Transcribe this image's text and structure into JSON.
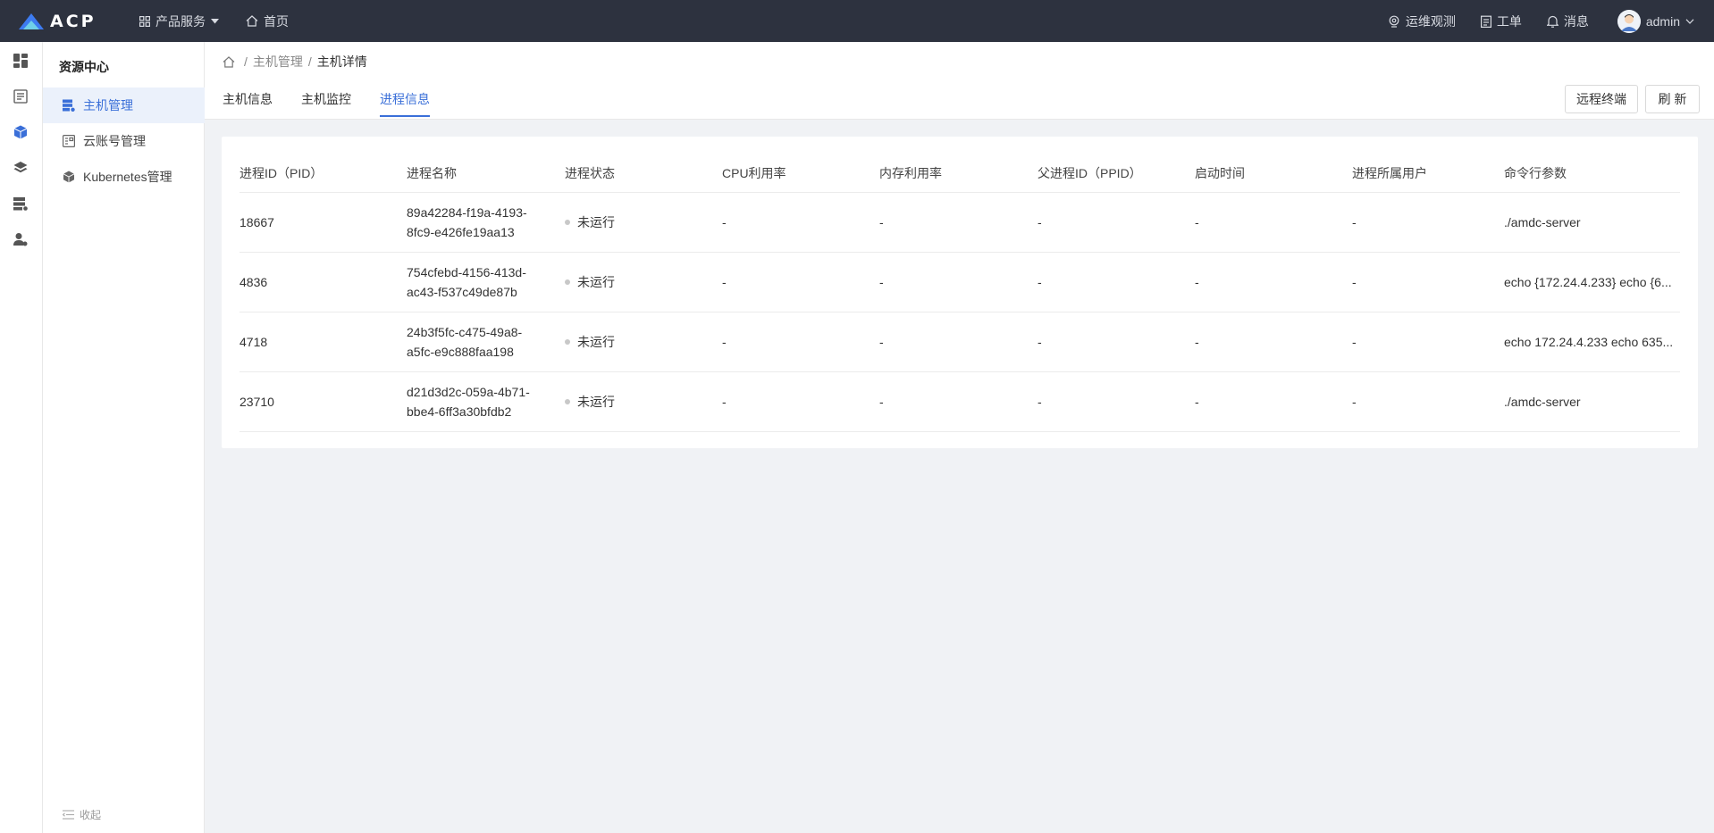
{
  "app": {
    "logo_text": "ACP"
  },
  "topnav": {
    "products": "产品服务",
    "home": "首页"
  },
  "topright": {
    "observe": "运维观测",
    "ticket": "工单",
    "message": "消息",
    "user": "admin"
  },
  "sidebar": {
    "title": "资源中心",
    "items": [
      {
        "label": "主机管理",
        "icon": "host-icon",
        "active": true
      },
      {
        "label": "云账号管理",
        "icon": "account-icon",
        "active": false
      },
      {
        "label": "Kubernetes管理",
        "icon": "cube-icon",
        "active": false
      }
    ],
    "collapse": "收起"
  },
  "breadcrumb": {
    "parent": "主机管理",
    "current": "主机详情"
  },
  "tabs": [
    "主机信息",
    "主机监控",
    "进程信息"
  ],
  "buttons": {
    "terminal": "远程终端",
    "refresh": "刷 新"
  },
  "table": {
    "headers": [
      "进程ID（PID）",
      "进程名称",
      "进程状态",
      "CPU利用率",
      "内存利用率",
      "父进程ID（PPID）",
      "启动时间",
      "进程所属用户",
      "命令行参数"
    ],
    "rows": [
      {
        "pid": "18667",
        "name1": "89a42284-f19a-4193-",
        "name2": "8fc9-e426fe19aa13",
        "status": "未运行",
        "cpu": "-",
        "mem": "-",
        "ppid": "-",
        "start": "-",
        "user": "-",
        "cmd": "./amdc-server"
      },
      {
        "pid": "4836",
        "name1": "754cfebd-4156-413d-",
        "name2": "ac43-f537c49de87b",
        "status": "未运行",
        "cpu": "-",
        "mem": "-",
        "ppid": "-",
        "start": "-",
        "user": "-",
        "cmd": "echo {172.24.4.233} echo {6..."
      },
      {
        "pid": "4718",
        "name1": "24b3f5fc-c475-49a8-",
        "name2": "a5fc-e9c888faa198",
        "status": "未运行",
        "cpu": "-",
        "mem": "-",
        "ppid": "-",
        "start": "-",
        "user": "-",
        "cmd": "echo 172.24.4.233 echo 635..."
      },
      {
        "pid": "23710",
        "name1": "d21d3d2c-059a-4b71-",
        "name2": "bbe4-6ff3a30bfdb2",
        "status": "未运行",
        "cpu": "-",
        "mem": "-",
        "ppid": "-",
        "start": "-",
        "user": "-",
        "cmd": "./amdc-server"
      }
    ]
  },
  "colors": {
    "accent": "#3a6fd8",
    "topbar": "#2d323f",
    "status_dot": "#c8c8c8"
  }
}
